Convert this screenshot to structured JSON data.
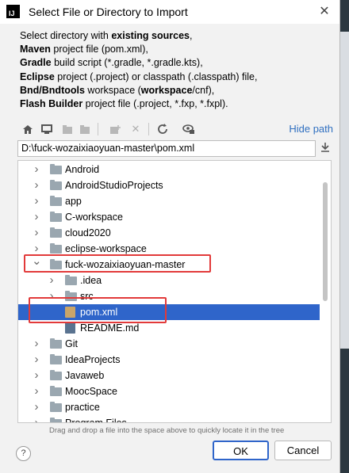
{
  "window": {
    "title": "Select File or Directory to Import",
    "logo_text": "IJ"
  },
  "description": [
    {
      "parts": [
        {
          "t": "Select directory with ",
          "b": false
        },
        {
          "t": "existing sources",
          "b": true
        },
        {
          "t": ",",
          "b": false
        }
      ]
    },
    {
      "parts": [
        {
          "t": "Maven",
          "b": true
        },
        {
          "t": " project file (pom.xml),",
          "b": false
        }
      ]
    },
    {
      "parts": [
        {
          "t": "Gradle",
          "b": true
        },
        {
          "t": " build script (*.gradle, *.gradle.kts),",
          "b": false
        }
      ]
    },
    {
      "parts": [
        {
          "t": "Eclipse",
          "b": true
        },
        {
          "t": " project (.project) or classpath (.classpath) file,",
          "b": false
        }
      ]
    },
    {
      "parts": [
        {
          "t": "Bnd/Bndtools",
          "b": true
        },
        {
          "t": " workspace (",
          "b": false
        },
        {
          "t": "workspace",
          "b": true
        },
        {
          "t": "/cnf),",
          "b": false
        }
      ]
    },
    {
      "parts": [
        {
          "t": "Flash Builder",
          "b": true
        },
        {
          "t": " project file (.project, *.fxp, *.fxpl).",
          "b": false
        }
      ]
    }
  ],
  "toolbar": {
    "hide_path_label": "Hide path",
    "buttons": [
      {
        "icon": "home-icon",
        "enabled": true
      },
      {
        "icon": "desktop-icon",
        "enabled": true
      },
      {
        "icon": "project-folder-icon",
        "enabled": false
      },
      {
        "icon": "module-folder-icon",
        "enabled": false
      },
      {
        "icon": "new-folder-icon",
        "enabled": false
      },
      {
        "icon": "delete-icon",
        "enabled": false
      },
      {
        "icon": "refresh-icon",
        "enabled": true
      },
      {
        "icon": "show-hidden-icon",
        "enabled": true
      }
    ]
  },
  "path": {
    "value": "D:\\fuck-wozaixiaoyuan-master\\pom.xml"
  },
  "tree": [
    {
      "label": "Android",
      "type": "folder",
      "depth": 0,
      "arrow": "collapsed"
    },
    {
      "label": "AndroidStudioProjects",
      "type": "folder",
      "depth": 0,
      "arrow": "collapsed"
    },
    {
      "label": "app",
      "type": "folder",
      "depth": 0,
      "arrow": "collapsed"
    },
    {
      "label": "C-workspace",
      "type": "folder",
      "depth": 0,
      "arrow": "collapsed"
    },
    {
      "label": "cloud2020",
      "type": "folder",
      "depth": 0,
      "arrow": "collapsed"
    },
    {
      "label": "eclipse-workspace",
      "type": "folder",
      "depth": 0,
      "arrow": "collapsed"
    },
    {
      "label": "fuck-wozaixiaoyuan-master",
      "type": "folder",
      "depth": 0,
      "arrow": "expanded"
    },
    {
      "label": ".idea",
      "type": "folder",
      "depth": 1,
      "arrow": "collapsed"
    },
    {
      "label": "src",
      "type": "folder",
      "depth": 1,
      "arrow": "collapsed"
    },
    {
      "label": "pom.xml",
      "type": "xml",
      "depth": 1,
      "arrow": "none",
      "selected": true
    },
    {
      "label": "README.md",
      "type": "md",
      "depth": 1,
      "arrow": "none"
    },
    {
      "label": "Git",
      "type": "folder",
      "depth": 0,
      "arrow": "collapsed"
    },
    {
      "label": "IdeaProjects",
      "type": "folder",
      "depth": 0,
      "arrow": "collapsed"
    },
    {
      "label": "Javaweb",
      "type": "folder",
      "depth": 0,
      "arrow": "collapsed"
    },
    {
      "label": "MoocSpace",
      "type": "folder",
      "depth": 0,
      "arrow": "collapsed"
    },
    {
      "label": "practice",
      "type": "folder",
      "depth": 0,
      "arrow": "collapsed"
    },
    {
      "label": "Program Files",
      "type": "folder",
      "depth": 0,
      "arrow": "collapsed"
    }
  ],
  "hint": "Drag and drop a file into the space above to quickly locate it in the tree",
  "buttons": {
    "help": "?",
    "ok": "OK",
    "cancel": "Cancel"
  },
  "colors": {
    "selection": "#2f65ca",
    "highlight_annotation": "#e23a3a",
    "link": "#2f6fc0"
  }
}
